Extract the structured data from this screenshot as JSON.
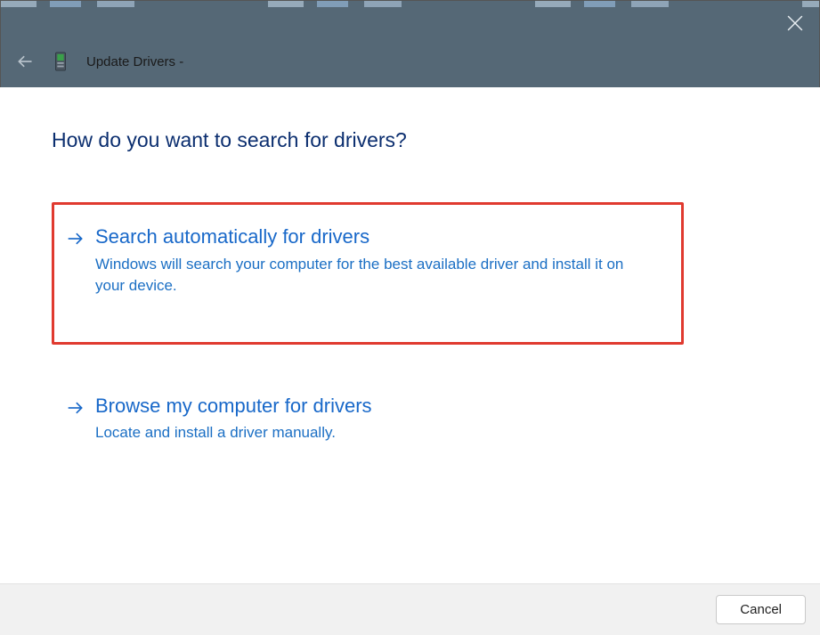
{
  "titlebar": {
    "back_enabled": false,
    "title": "Update Drivers -"
  },
  "page": {
    "heading": "How do you want to search for drivers?"
  },
  "options": [
    {
      "title": "Search automatically for drivers",
      "description": "Windows will search your computer for the best available driver and install it on your device.",
      "highlighted": true
    },
    {
      "title": "Browse my computer for drivers",
      "description": "Locate and install a driver manually.",
      "highlighted": false
    }
  ],
  "footer": {
    "cancel_label": "Cancel"
  }
}
